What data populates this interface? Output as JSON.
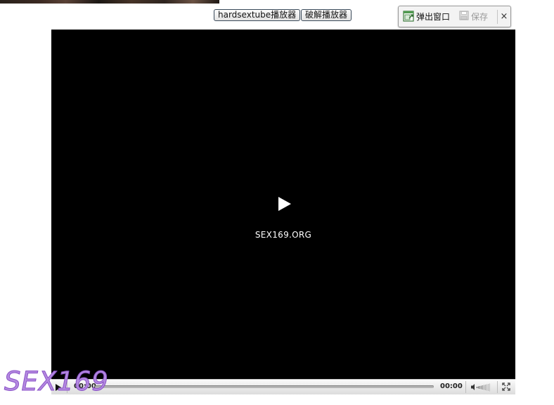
{
  "top_buttons": {
    "hardsextube_label": "hardsextube播放器",
    "crack_label": "破解播放器"
  },
  "popup_toolbar": {
    "popout_label": "弹出窗口",
    "save_label": "保存",
    "close_label": "×"
  },
  "video": {
    "watermark_text": "SEX169.ORG"
  },
  "controls": {
    "current_time": "00:00",
    "total_time": "00:00",
    "progress": 0
  },
  "logo": {
    "text": "SEX169"
  },
  "colors": {
    "video_background": "#000000",
    "logo_purple": "#b48ae0"
  },
  "icons": {
    "play_big": "play-icon",
    "play_small": "play-icon",
    "volume": "volume-icon",
    "fullscreen": "fullscreen-icon",
    "popout": "popout-window-icon",
    "save": "floppy-disk-icon",
    "close": "close-icon"
  }
}
